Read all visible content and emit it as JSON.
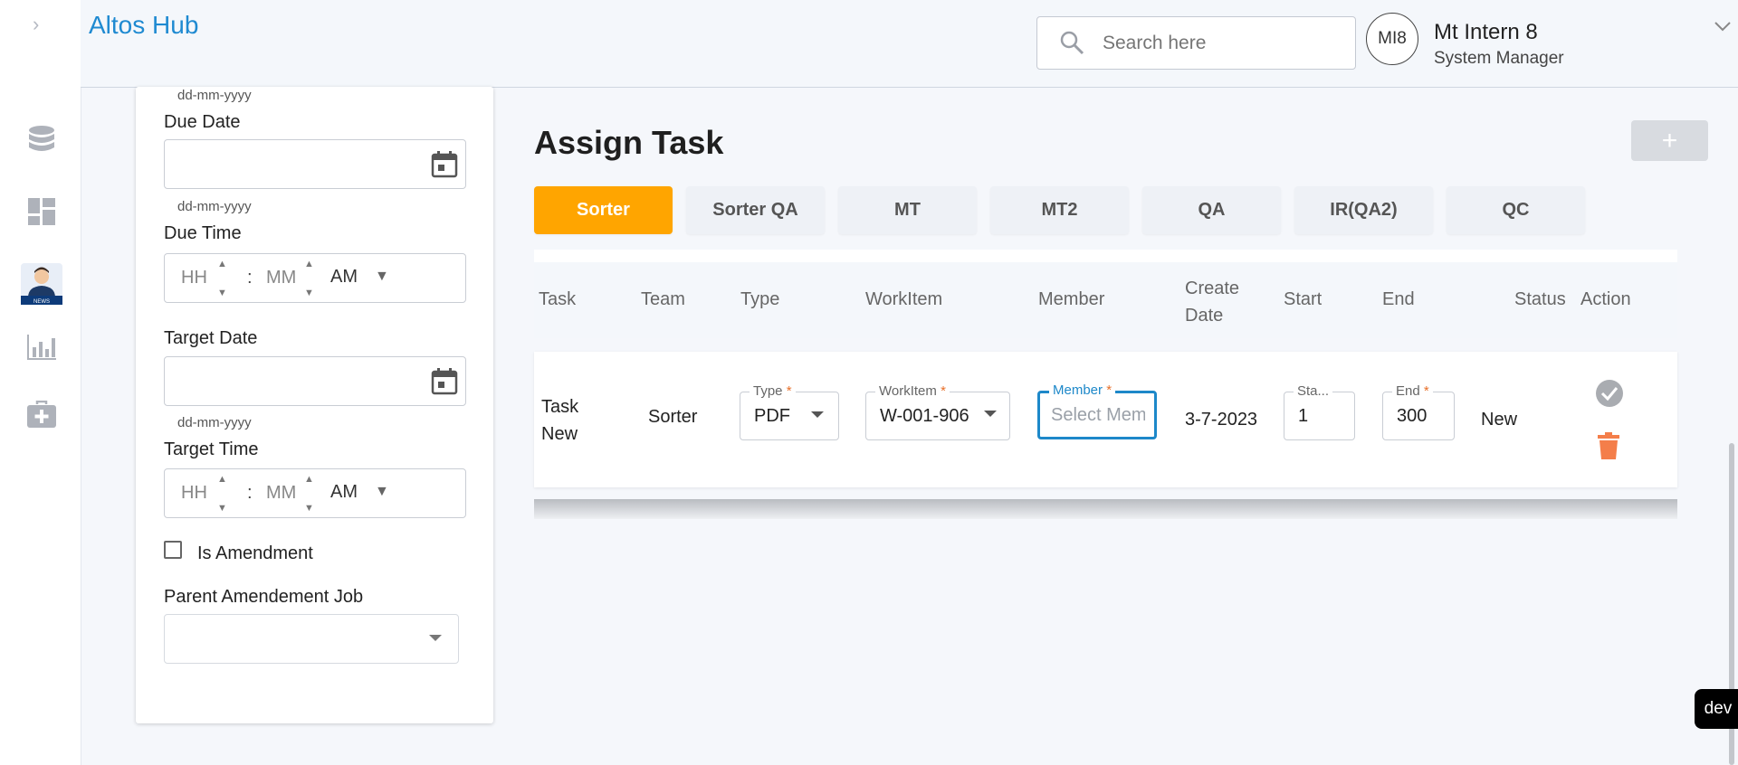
{
  "app": {
    "brand": "Altos Hub"
  },
  "header": {
    "search_placeholder": "Search here",
    "user_initials": "MI8",
    "user_name": "Mt Intern 8",
    "user_role": "System Manager"
  },
  "sidebar": {
    "items": [
      {
        "icon": "database-icon"
      },
      {
        "icon": "dashboard-icon"
      },
      {
        "icon": "news-avatar-icon"
      },
      {
        "icon": "bar-chart-icon"
      },
      {
        "icon": "medical-kit-icon"
      }
    ]
  },
  "form": {
    "date_hint_top": "dd-mm-yyyy",
    "due_date_label": "Due Date",
    "due_date_hint": "dd-mm-yyyy",
    "due_time_label": "Due Time",
    "target_date_label": "Target Date",
    "target_date_hint": "dd-mm-yyyy",
    "target_time_label": "Target Time",
    "time": {
      "hh": "HH",
      "mm": "MM",
      "colon": ":",
      "ampm": "AM"
    },
    "amendment_label": "Is Amendment",
    "parent_job_label": "Parent Amendement Job"
  },
  "main": {
    "title": "Assign Task",
    "add_label": "+",
    "tabs": [
      "Sorter",
      "Sorter QA",
      "MT",
      "MT2",
      "QA",
      "IR(QA2)",
      "QC"
    ],
    "active_tab": "Sorter",
    "columns": [
      "Task",
      "Team",
      "Type",
      "WorkItem",
      "Member",
      "Create Date",
      "Start",
      "End",
      "Status",
      "Action"
    ],
    "row": {
      "task": "Task New",
      "team": "Sorter",
      "type_label": "Type",
      "type_value": "PDF",
      "workitem_label": "WorkItem",
      "workitem_value": "W-001-906",
      "member_label": "Member",
      "member_placeholder": "Select Mem",
      "create_date": "3-7-2023",
      "start_label": "Sta...",
      "start_value": "1",
      "end_label": "End",
      "end_value": "300",
      "status": "New",
      "required_mark": "*"
    }
  },
  "dev_badge": "dev",
  "colors": {
    "brand": "#1f8ad1",
    "active_tab": "#ffa500",
    "delete": "#f47e4a",
    "focus": "#1d88c9"
  }
}
